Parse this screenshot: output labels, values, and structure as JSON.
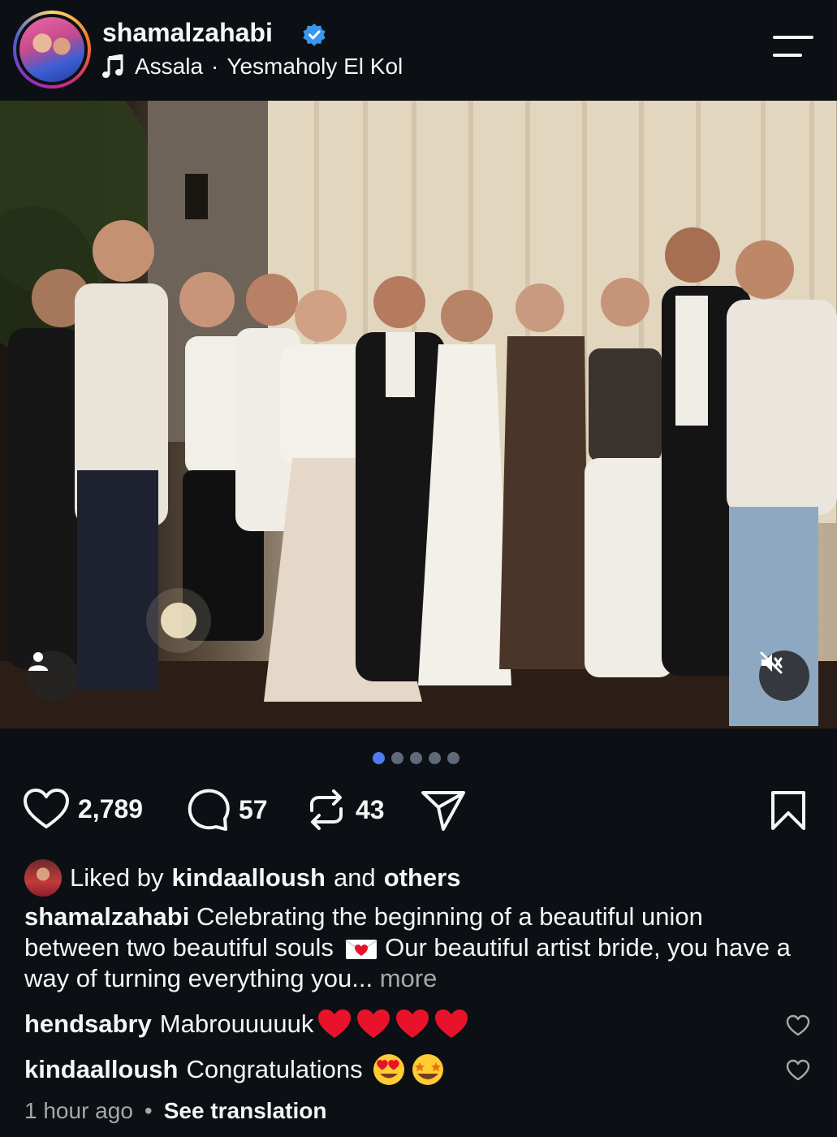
{
  "header": {
    "username": "shamalzahabi",
    "music_artist": "Assala",
    "music_separator": "·",
    "music_title": "Yesmaholy El Kol"
  },
  "carousel": {
    "count": 5,
    "active_index": 0
  },
  "actions": {
    "likes": "2,789",
    "comments": "57",
    "reposts": "43"
  },
  "liked_by": {
    "prefix": "Liked by",
    "user": "kindaalloush",
    "middle": "and",
    "others": "others"
  },
  "caption": {
    "username": "shamalzahabi",
    "text_1": "Celebrating the beginning of a beautiful union between two beautiful souls",
    "text_2": "Our beautiful artist bride, you have a way of turning everything you...",
    "more": "more"
  },
  "comments": [
    {
      "username": "hendsabry",
      "text": "Mabrouuuuuk"
    },
    {
      "username": "kindaalloush",
      "text": "Congratulations"
    }
  ],
  "footer": {
    "time": "1 hour ago",
    "separator": "•",
    "translate": "See translation"
  },
  "colors": {
    "background": "#0c1014",
    "verified": "#3897f0",
    "active_dot": "#4e7cf5",
    "heart_red": "#e8132b"
  }
}
